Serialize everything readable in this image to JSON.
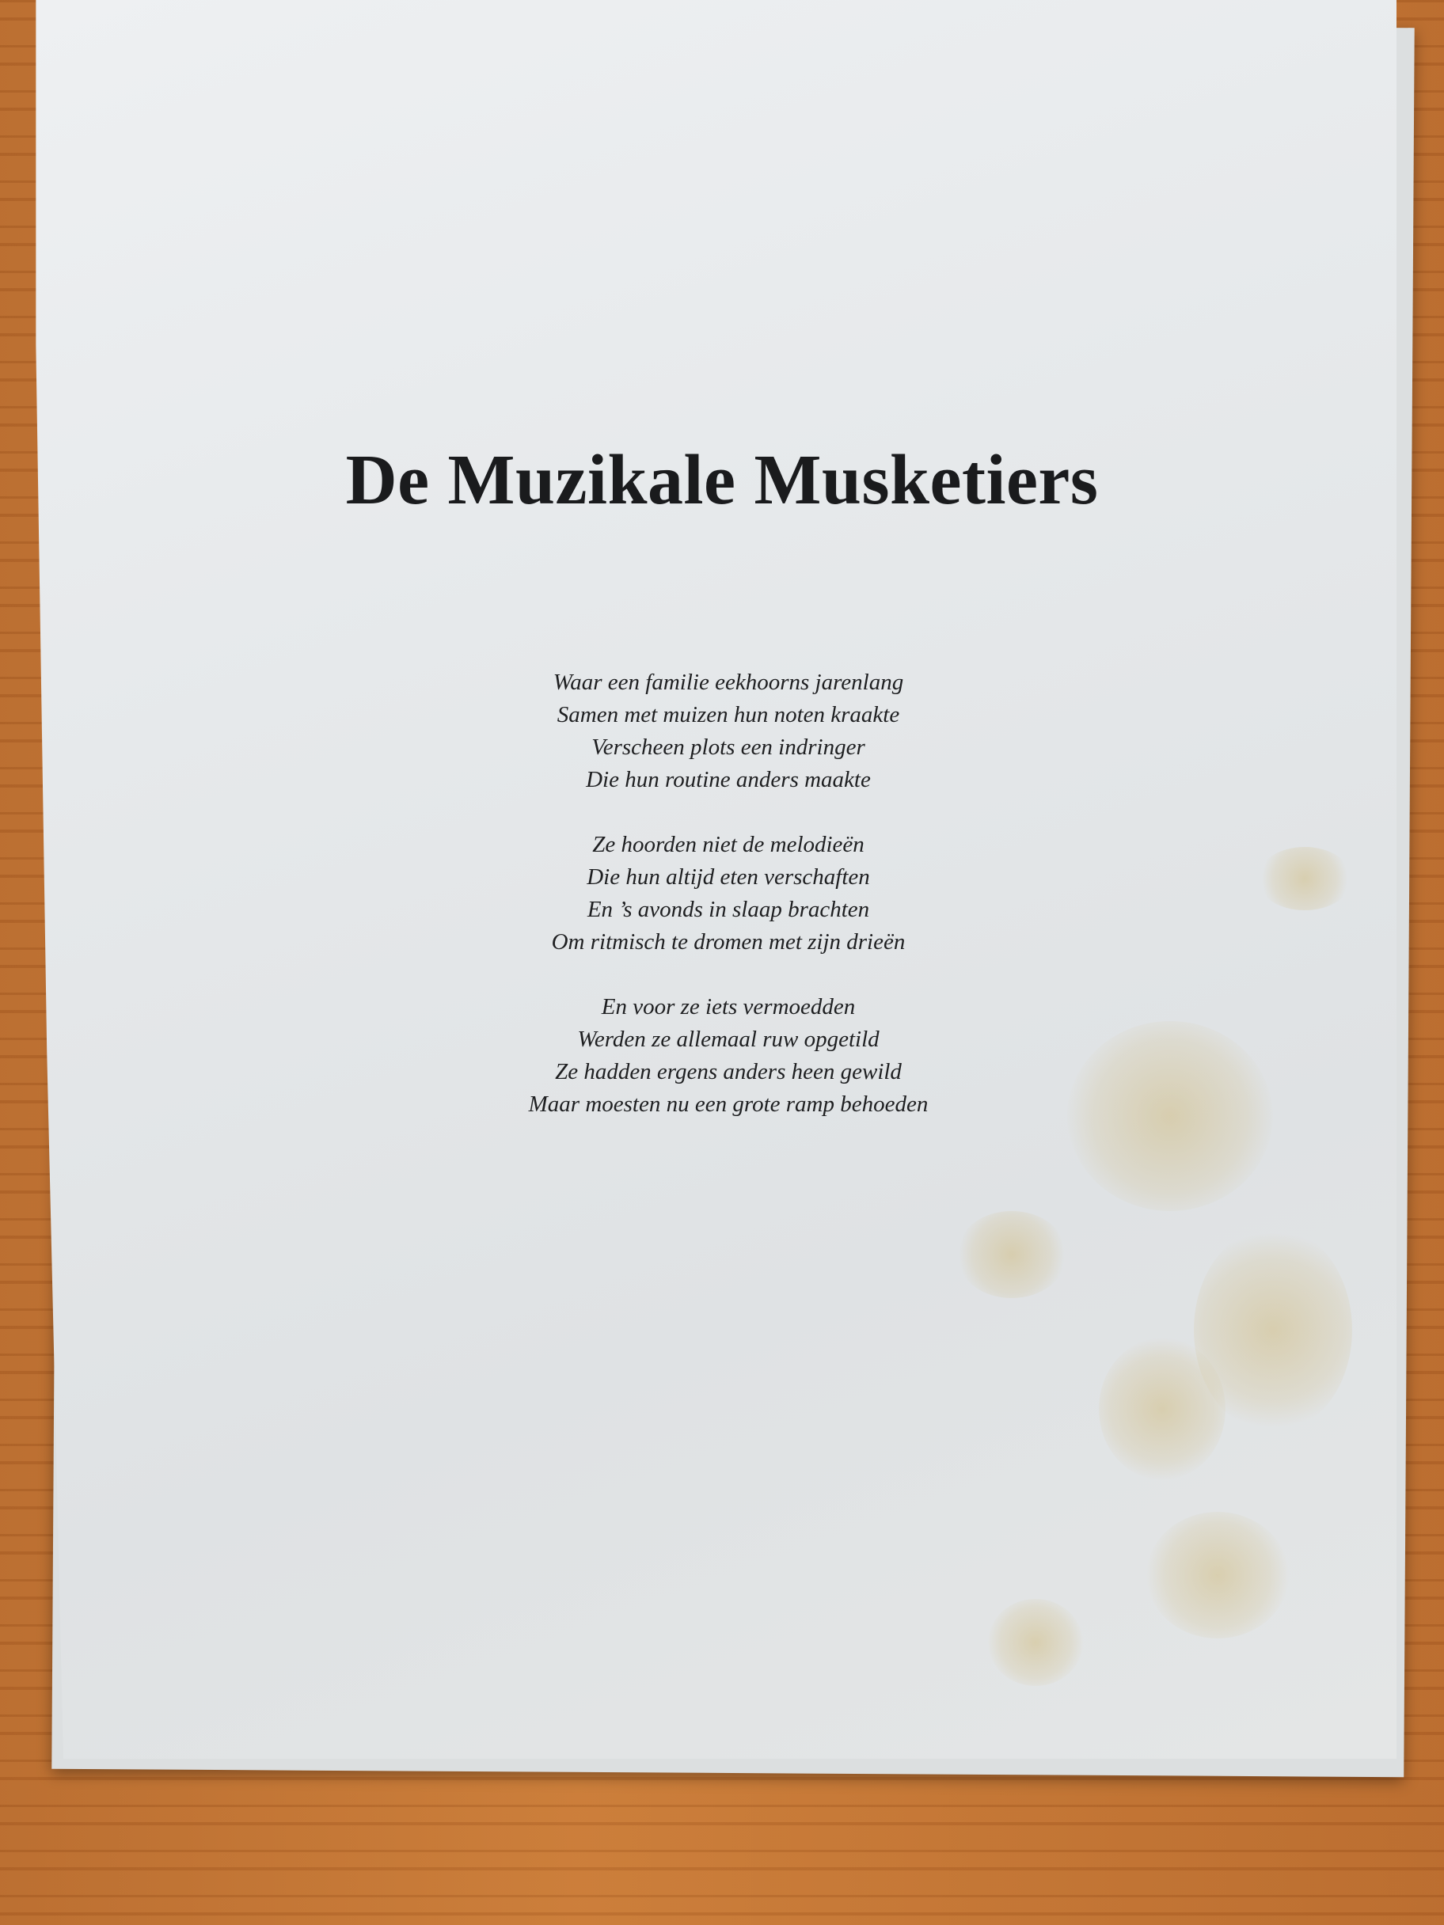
{
  "document": {
    "title": "De Muzikale Musketiers",
    "stanzas": [
      {
        "lines": [
          "Waar een familie eekhoorns jarenlang",
          "Samen met muizen hun noten kraakte",
          "Verscheen plots een indringer",
          "Die hun routine anders maakte"
        ]
      },
      {
        "lines": [
          "Ze hoorden niet de melodieën",
          "Die hun altijd eten verschaften",
          "En ’s avonds in slaap brachten",
          "Om ritmisch te dromen met zijn drieën"
        ]
      },
      {
        "lines": [
          "En voor ze iets vermoedden",
          "Werden ze allemaal ruw opgetild",
          "Ze hadden ergens anders heen gewild",
          "Maar moesten nu een grote ramp behoeden"
        ]
      }
    ]
  },
  "colors": {
    "paper": "#e6e9eb",
    "ink": "#1a1b1d",
    "table": "#c97a36"
  }
}
